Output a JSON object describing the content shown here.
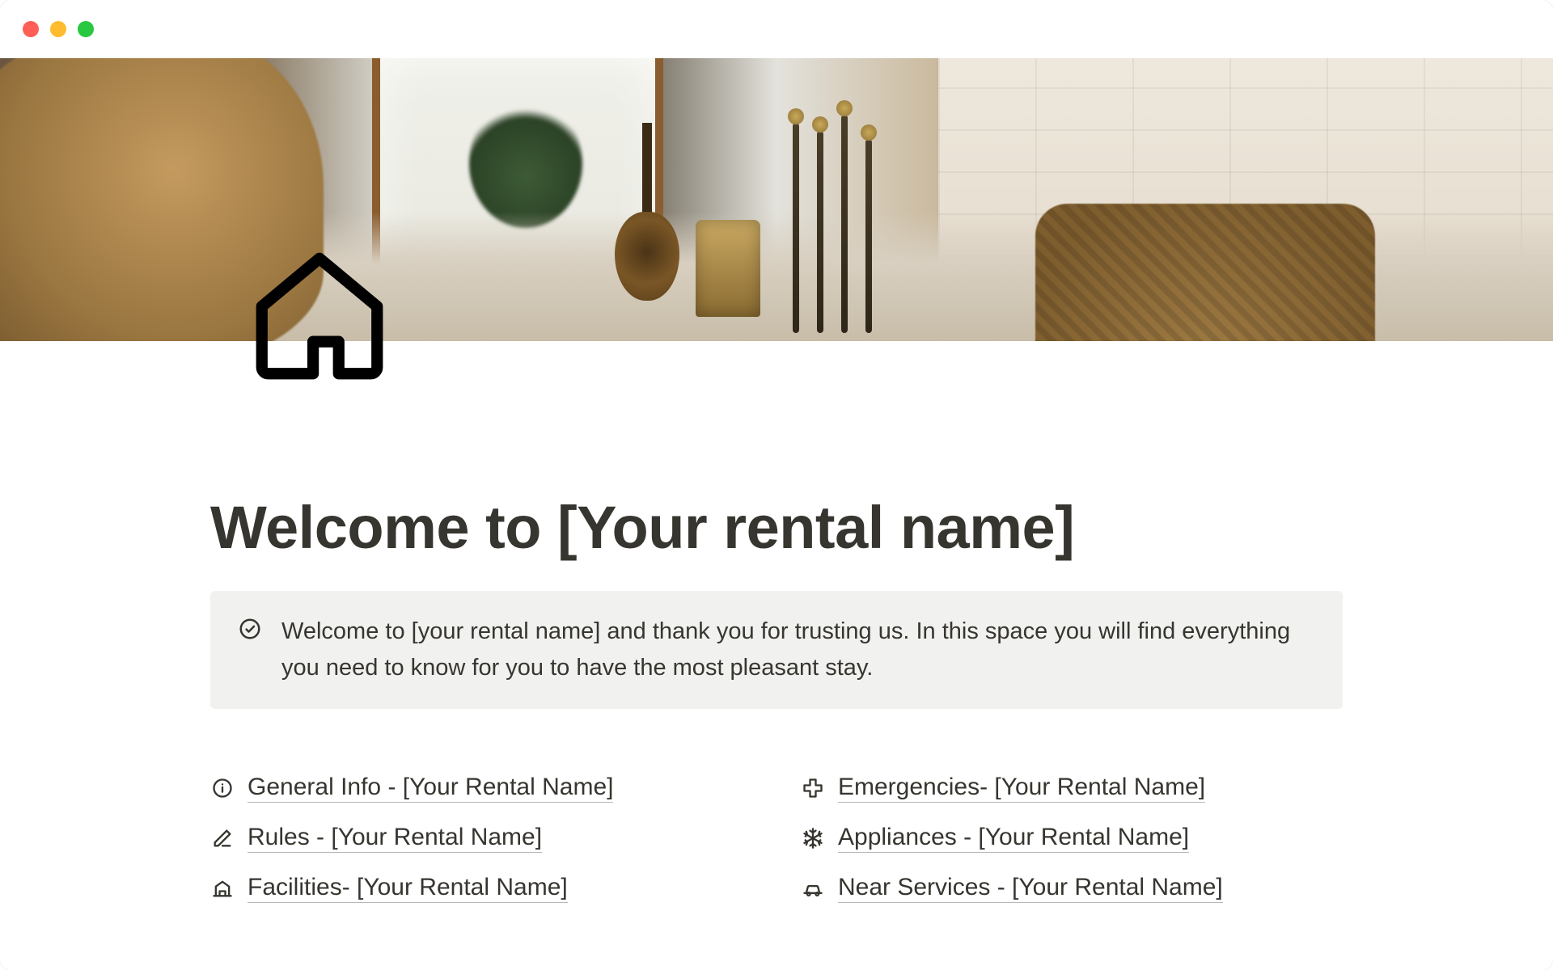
{
  "page": {
    "title": "Welcome to [Your rental name]"
  },
  "callout": {
    "text": "Welcome to [your rental name] and thank you for trusting us. In this space you will find everything you need to know for you to have the most pleasant stay."
  },
  "links": {
    "left": [
      {
        "icon": "info",
        "label": "General Info - [Your Rental Name]"
      },
      {
        "icon": "edit",
        "label": "Rules - [Your Rental Name]"
      },
      {
        "icon": "house",
        "label": "Facilities- [Your Rental Name]"
      }
    ],
    "right": [
      {
        "icon": "plus-medical",
        "label": "Emergencies- [Your Rental Name]"
      },
      {
        "icon": "snowflake",
        "label": "Appliances - [Your Rental Name]"
      },
      {
        "icon": "car",
        "label": "Near Services - [Your Rental Name]"
      }
    ]
  }
}
